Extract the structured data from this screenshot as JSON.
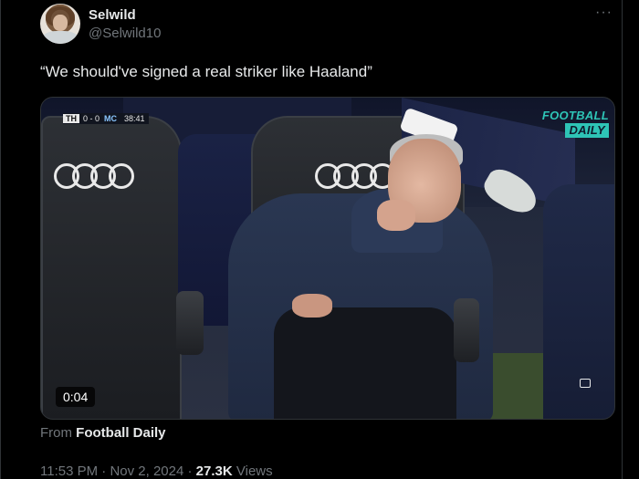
{
  "author": {
    "name": "Selwild",
    "handle": "@Selwild10"
  },
  "menu": {
    "more_icon": "more-horizontal-icon",
    "more_label": "···"
  },
  "tweet": {
    "text": "“We should've signed a real striker like Haaland”"
  },
  "video": {
    "scorebug": {
      "home": "TH",
      "score": "0 - 0",
      "away": "MC",
      "clock": "38:41"
    },
    "logo_line1": "FOOTBALL",
    "logo_line2": "DAILY",
    "duration": "0:04",
    "sponsor_logo": "four-rings-logo",
    "expand_icon": "expand-icon"
  },
  "source": {
    "prefix": "From",
    "name": "Football Daily"
  },
  "meta": {
    "time": "11:53 PM",
    "separator": "·",
    "date": "Nov 2, 2024",
    "views_count": "27.3K",
    "views_label": "Views"
  },
  "colors": {
    "background": "#000000",
    "text": "#e7e9ea",
    "muted": "#71767b",
    "brand_teal": "#2ec4b6"
  }
}
